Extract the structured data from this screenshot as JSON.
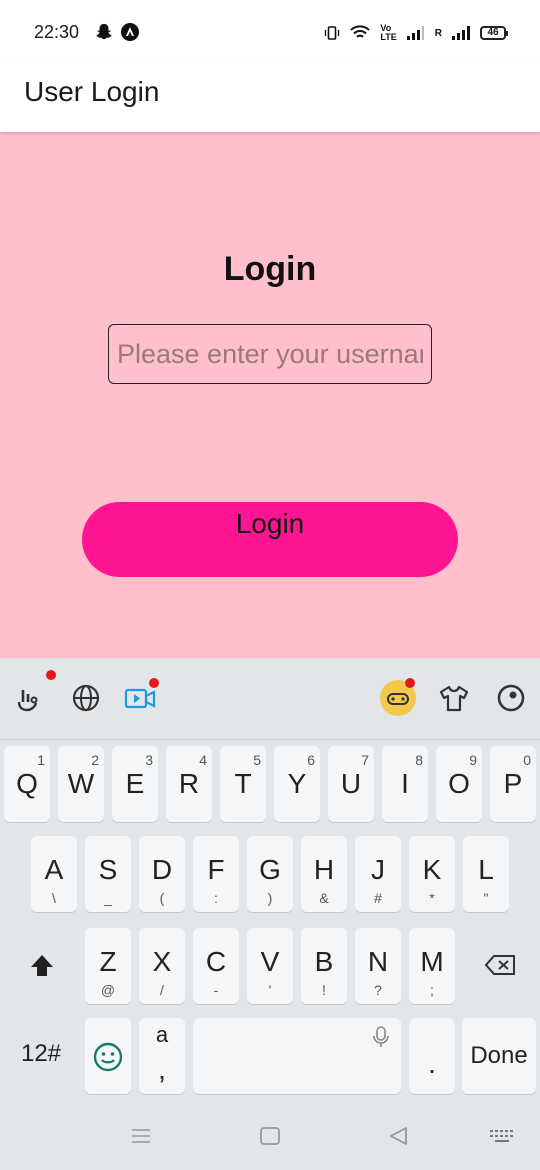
{
  "status_bar": {
    "time": "22:30",
    "indicators": [
      "vibrate-icon",
      "wifi-icon",
      "volte-icon",
      "signal-icon",
      "signal-roaming-icon"
    ],
    "volte_label": "Vo\nLTE",
    "roaming_label": "R",
    "battery_level": "46"
  },
  "app_bar": {
    "title": "User Login"
  },
  "form": {
    "heading": "Login",
    "username_placeholder": "Please enter your username",
    "login_label": "Login"
  },
  "colors": {
    "background": "#ffbfcb",
    "button": "#ff1493",
    "keyboard": "#e3e6e8"
  },
  "keyboard": {
    "toolbar_icons": [
      "gesture-icon",
      "globe-icon",
      "video-icon",
      "game-icon",
      "theme-shirt-icon",
      "assistant-icon"
    ],
    "row1": [
      {
        "key": "Q",
        "hint": "1"
      },
      {
        "key": "W",
        "hint": "2"
      },
      {
        "key": "E",
        "hint": "3"
      },
      {
        "key": "R",
        "hint": "4"
      },
      {
        "key": "T",
        "hint": "5"
      },
      {
        "key": "Y",
        "hint": "6"
      },
      {
        "key": "U",
        "hint": "7"
      },
      {
        "key": "I",
        "hint": "8"
      },
      {
        "key": "O",
        "hint": "9"
      },
      {
        "key": "P",
        "hint": "0"
      }
    ],
    "row2": [
      {
        "key": "A",
        "sub": "\\"
      },
      {
        "key": "S",
        "sub": "_"
      },
      {
        "key": "D",
        "sub": "("
      },
      {
        "key": "F",
        "sub": ":"
      },
      {
        "key": "G",
        "sub": ")"
      },
      {
        "key": "H",
        "sub": "&"
      },
      {
        "key": "J",
        "sub": "#"
      },
      {
        "key": "K",
        "sub": "*"
      },
      {
        "key": "L",
        "sub": "\""
      }
    ],
    "row3": [
      {
        "key": "Z",
        "sub": "@"
      },
      {
        "key": "X",
        "sub": "/"
      },
      {
        "key": "C",
        "sub": "-"
      },
      {
        "key": "V",
        "sub": "'"
      },
      {
        "key": "B",
        "sub": "!"
      },
      {
        "key": "N",
        "sub": "?"
      },
      {
        "key": "M",
        "sub": ";"
      }
    ],
    "numbers_key": "12#",
    "comma_key": "a",
    "comma_sub": ",",
    "period_key": ".",
    "done_key": "Done"
  }
}
